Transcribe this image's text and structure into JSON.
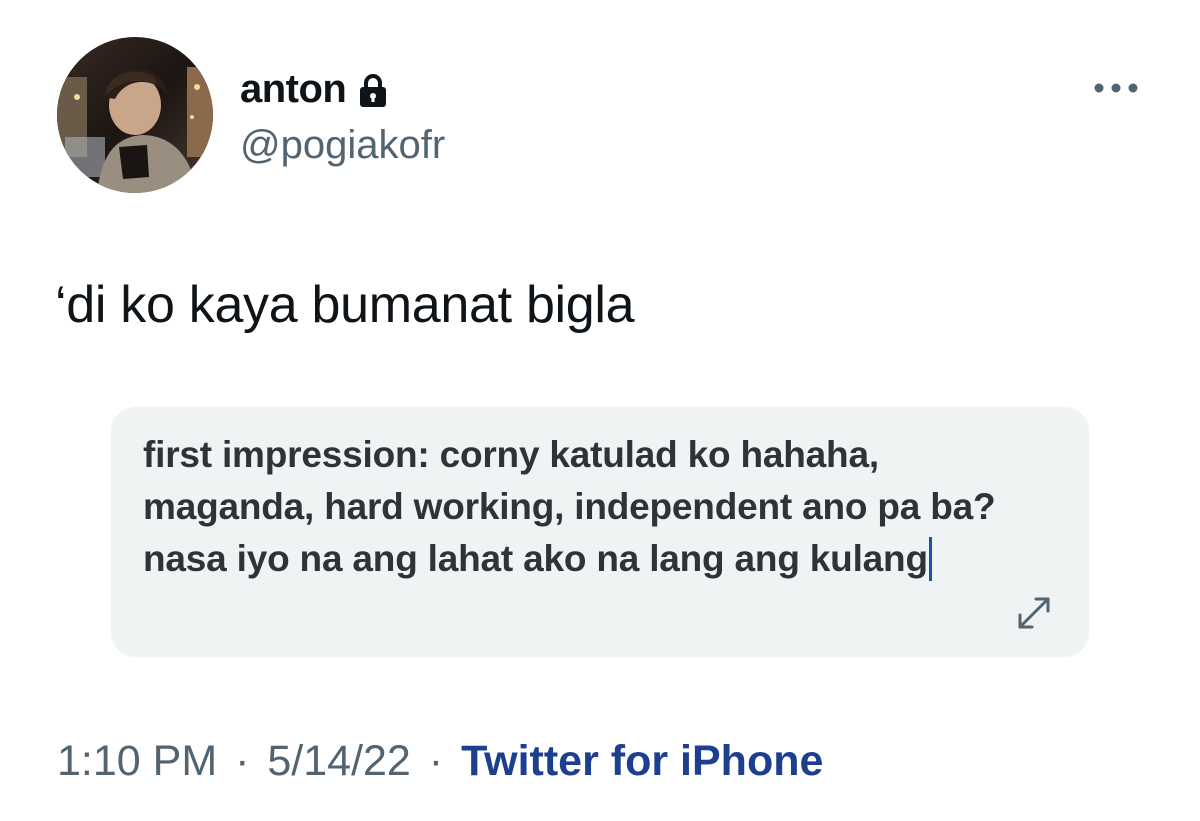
{
  "tweet": {
    "author": {
      "display_name": "anton",
      "handle": "@pogiakofr",
      "protected_icon": "lock-icon"
    },
    "more_icon": "more-horizontal-icon",
    "text": "‘di ko kaya bumanat bigla",
    "quoted_text": "first impression: corny katulad ko hahaha, maganda, hard working, independent ano pa ba? nasa iyo na ang lahat ako na lang ang kulang",
    "expand_icon": "expand-arrows-icon",
    "meta": {
      "time": "1:10 PM",
      "separator": "·",
      "date": "5/14/22",
      "source": "Twitter for iPhone"
    },
    "colors": {
      "handle": "#536471",
      "source_link": "#1d3f8f",
      "quote_background": "#eff3f4",
      "caret": "#1d4fb8"
    }
  }
}
